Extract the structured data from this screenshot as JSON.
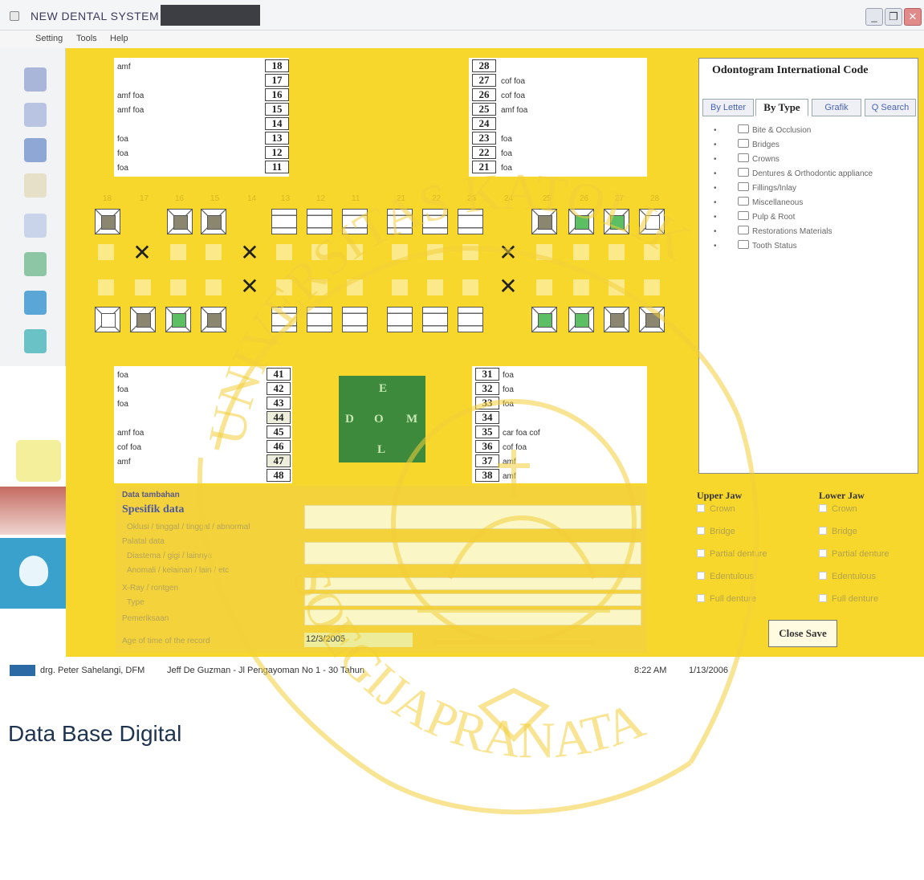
{
  "window": {
    "title": "NEW DENTAL SYSTEM",
    "min_label": "_",
    "restore_label": "❐",
    "close_label": "✕"
  },
  "menu": [
    "Setting",
    "Tools",
    "Help"
  ],
  "quadrants": {
    "upper_right": [
      {
        "num": "18",
        "text": "amf"
      },
      {
        "num": "17",
        "text": ""
      },
      {
        "num": "16",
        "text": "amf foa"
      },
      {
        "num": "15",
        "text": "amf foa"
      },
      {
        "num": "14",
        "text": ""
      },
      {
        "num": "13",
        "text": "foa"
      },
      {
        "num": "12",
        "text": "foa"
      },
      {
        "num": "11",
        "text": "foa"
      }
    ],
    "upper_left": [
      {
        "num": "28",
        "text": ""
      },
      {
        "num": "27",
        "text": "cof foa"
      },
      {
        "num": "26",
        "text": "cof foa"
      },
      {
        "num": "25",
        "text": "amf foa"
      },
      {
        "num": "24",
        "text": ""
      },
      {
        "num": "23",
        "text": "foa"
      },
      {
        "num": "22",
        "text": "foa"
      },
      {
        "num": "21",
        "text": "foa"
      }
    ],
    "lower_right": [
      {
        "num": "41",
        "text": "foa"
      },
      {
        "num": "42",
        "text": "foa"
      },
      {
        "num": "43",
        "text": "foa"
      },
      {
        "num": "44",
        "text": ""
      },
      {
        "num": "45",
        "text": "amf foa"
      },
      {
        "num": "46",
        "text": "cof foa"
      },
      {
        "num": "47",
        "text": "amf"
      },
      {
        "num": "48",
        "text": ""
      }
    ],
    "lower_left": [
      {
        "num": "31",
        "text": "foa"
      },
      {
        "num": "32",
        "text": "foa"
      },
      {
        "num": "33",
        "text": "foa"
      },
      {
        "num": "34",
        "text": ""
      },
      {
        "num": "35",
        "text": "car foa cof"
      },
      {
        "num": "36",
        "text": "cof foa"
      },
      {
        "num": "37",
        "text": "amf"
      },
      {
        "num": "38",
        "text": "amf"
      }
    ]
  },
  "tooth_numbers_upper": [
    "18",
    "17",
    "16",
    "15",
    "14",
    "13",
    "12",
    "11",
    "21",
    "22",
    "23",
    "24",
    "25",
    "26",
    "27",
    "28"
  ],
  "logo_letters": [
    "E",
    "D",
    "O",
    "M",
    "L"
  ],
  "form": {
    "section_label": "Data tambahan",
    "heading": "Spesifik data",
    "faded_labels": [
      "Oklusi / tinggal / tinggal / abnormal",
      "Palatal data",
      "Diastema / gigi / lainnya",
      "Anomali / kelainan / lain / etc",
      "X-Ray / rontgen",
      "Type",
      "Pemeriksaan",
      "Age of time of the record"
    ],
    "date_value": "12/3/2005"
  },
  "right_panel": {
    "title": "Odontogram International Code",
    "tabs": [
      "By Letter",
      "By Type",
      "Grafik",
      "Q Search"
    ],
    "tree_items": [
      "Bite & Occlusion",
      "Bridges",
      "Crowns",
      "Dentures & Orthodontic appliance",
      "Fillings/Inlay",
      "Miscellaneous",
      "Pulp & Root",
      "Restorations Materials",
      "Tooth Status"
    ],
    "upper_jaw_label": "Upper Jaw",
    "lower_jaw_label": "Lower Jaw",
    "jaw_options": [
      "Crown",
      "Bridge",
      "Partial denture",
      "Edentulous",
      "Full denture"
    ],
    "close_save_label": "Close Save"
  },
  "statusbar": {
    "doctor": "drg. Peter Sahelangi, DFM",
    "patient": "Jeff De Guzman - Jl Pengayoman No 1 - 30 Tahun",
    "time": "8:22 AM",
    "date": "1/13/2006"
  },
  "caption": "Data Base Digital",
  "watermark_text": "UNIVERSITAS KATOLIK SOEGIJAPRANATA",
  "colors": {
    "panel_yellow": "#f7d72c",
    "fill_gray": "#8a8670",
    "fill_green": "#5cbf63",
    "watermark": "#f3cf3a"
  }
}
